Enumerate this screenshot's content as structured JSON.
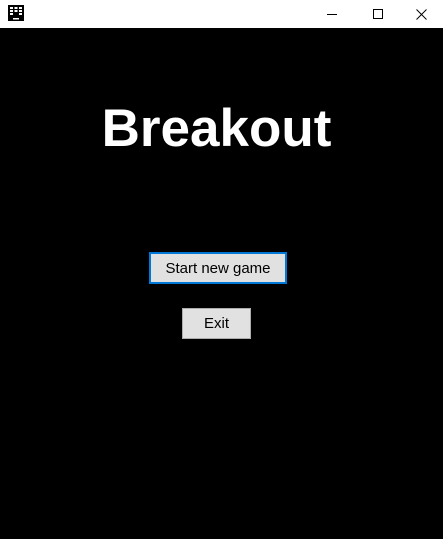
{
  "window": {
    "app_icon": "breakout-app-icon",
    "controls": {
      "minimize_icon": "minimize-icon",
      "maximize_icon": "maximize-icon",
      "close_icon": "close-icon"
    }
  },
  "menu": {
    "title": "Breakout",
    "start_button_label": "Start new game",
    "exit_button_label": "Exit"
  },
  "colors": {
    "background": "#000000",
    "title_text": "#ffffff",
    "button_face": "#e1e1e1",
    "focus_border": "#0078d7"
  }
}
